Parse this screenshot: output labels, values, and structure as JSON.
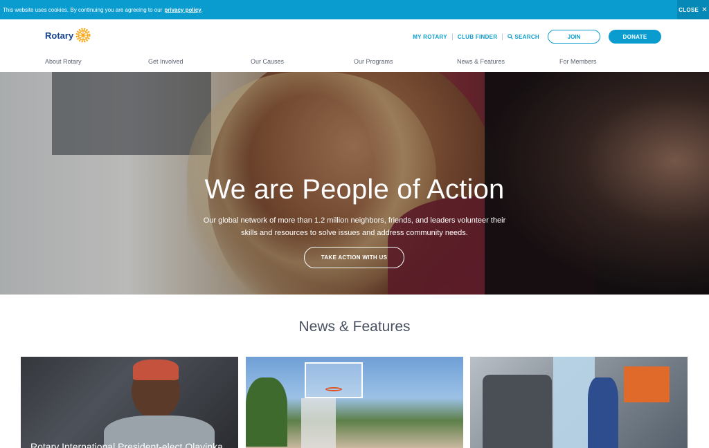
{
  "cookie_bar": {
    "message": "This website uses cookies. By continuing you are agreeing to our",
    "link": "privacy policy",
    "suffix": ".",
    "close": "CLOSE",
    "close_icon": "close-icon"
  },
  "header": {
    "logo_text": "Rotary",
    "logo_icon": "rotary-wheel-icon",
    "utility": {
      "my_rotary": "MY ROTARY",
      "club_finder": "CLUB FINDER",
      "search": "SEARCH",
      "search_icon": "search-icon",
      "join": "JOIN",
      "donate": "DONATE"
    },
    "nav": [
      "About Rotary",
      "Get Involved",
      "Our Causes",
      "Our Programs",
      "News & Features",
      "For Members"
    ]
  },
  "hero": {
    "title": "We are People of Action",
    "subtitle_line1": "Our global network of more than 1.2 million neighbors, friends, and leaders volunteer their",
    "subtitle_line2": "skills and resources to solve issues and address community needs.",
    "cta": "TAKE ACTION WITH US"
  },
  "news": {
    "title": "News & Features",
    "cards": [
      {
        "text": "Rotary International President-elect Olayinka"
      },
      {
        "text": ""
      },
      {
        "text": ""
      }
    ]
  },
  "colors": {
    "accent": "#0a9ccf",
    "brand_blue": "#17458f",
    "gold": "#f7a81b"
  }
}
